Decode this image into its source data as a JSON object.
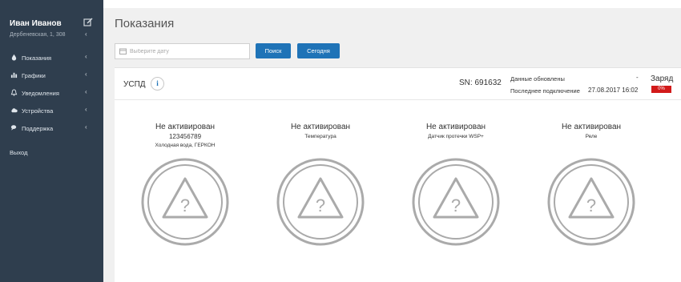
{
  "sidebar": {
    "user_name": "Иван Иванов",
    "user_address": "Дербеневская, 1, 308",
    "items": [
      {
        "label": "Показания",
        "icon": "drop-icon"
      },
      {
        "label": "Графики",
        "icon": "bar-chart-icon"
      },
      {
        "label": "Уведомления",
        "icon": "bell-icon"
      },
      {
        "label": "Устройства",
        "icon": "cloud-icon"
      },
      {
        "label": "Поддержка",
        "icon": "chat-icon"
      }
    ],
    "logout_label": "Выход"
  },
  "main": {
    "title": "Показания",
    "date_placeholder": "Выберите дату",
    "search_label": "Поиск",
    "today_label": "Сегодня"
  },
  "device": {
    "name": "УСПД",
    "info_glyph": "i",
    "sn": "SN: 691632",
    "updated_label": "Данные обновлены",
    "updated_value": "-",
    "last_connection_label": "Последнее подключение",
    "last_connection_value": "27.08.2017 16:02",
    "charge_label": "Заряд",
    "charge_value": "0%",
    "charge_color": "#d21a1a"
  },
  "sensors": [
    {
      "status": "Не активирован",
      "serial": "123456789",
      "type": "Холодная вода, ГЕРКОН",
      "icon": "warning-icon"
    },
    {
      "status": "Не активирован",
      "serial": "",
      "type": "Температура",
      "icon": "warning-icon"
    },
    {
      "status": "Не активирован",
      "serial": "",
      "type": "Датчик протечки WSP+",
      "icon": "warning-icon"
    },
    {
      "status": "Не активирован",
      "serial": "",
      "type": "Реле",
      "icon": "warning-icon"
    }
  ],
  "colors": {
    "sidebar_bg": "#2f3e4e",
    "accent": "#1f73b7",
    "alert": "#d21a1a"
  }
}
